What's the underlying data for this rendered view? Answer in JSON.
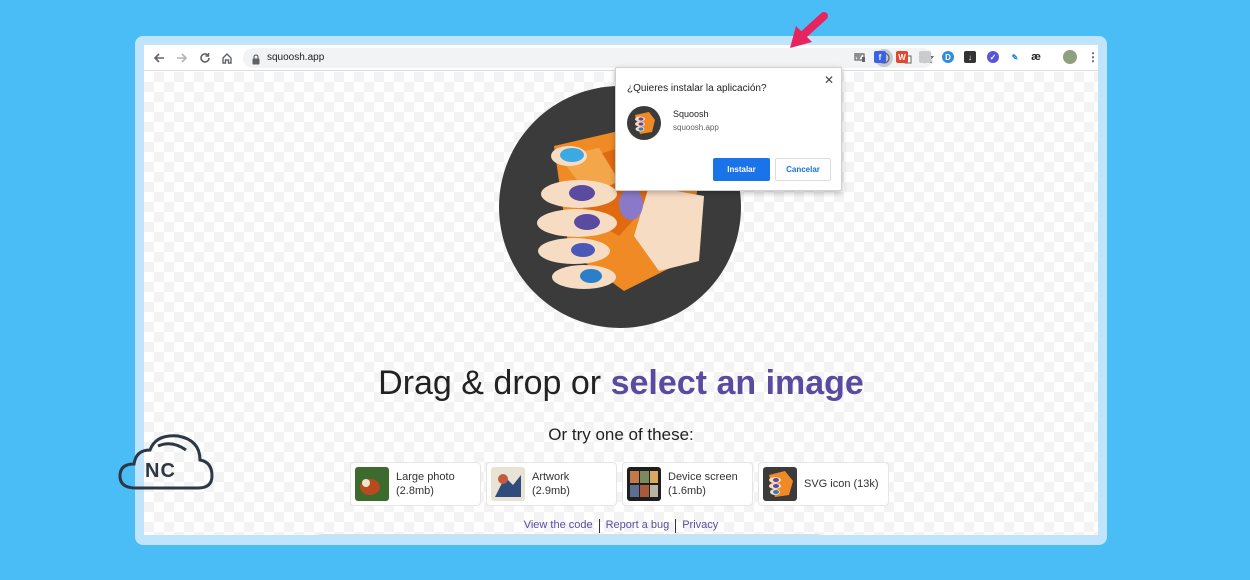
{
  "browser": {
    "url": "squoosh.app"
  },
  "page": {
    "headline_prefix": "Drag & drop or ",
    "headline_link": "select an image",
    "subhead": "Or try one of these:",
    "samples": [
      {
        "label": "Large photo",
        "size": "(2.8mb)"
      },
      {
        "label": "Artwork",
        "size": "(2.9mb)"
      },
      {
        "label": "Device screen",
        "size": "(1.6mb)"
      },
      {
        "label": "SVG icon (13k)",
        "size": ""
      }
    ],
    "footer": {
      "code": "View the code",
      "bug": "Report a bug",
      "privacy": "Privacy"
    }
  },
  "popup": {
    "title": "¿Quieres instalar la aplicación?",
    "close": "✕",
    "app_name": "Squoosh",
    "app_url": "squoosh.app",
    "install": "Instalar",
    "cancel": "Cancelar"
  },
  "colors": {
    "background": "#4bbdf6",
    "accent": "#5b4ba0",
    "install_button": "#1a73e8",
    "arrow": "#e8245f"
  },
  "brand": {
    "nc_text": "NC"
  }
}
